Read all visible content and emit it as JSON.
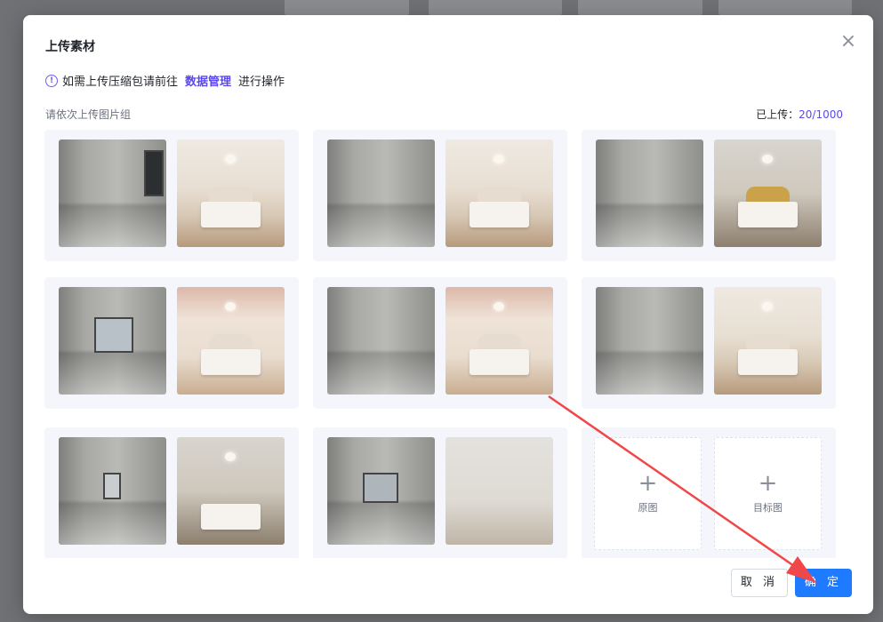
{
  "dialog": {
    "title": "上传素材",
    "notice": {
      "prefix": "如需上传压缩包请前往",
      "link": "数据管理",
      "suffix": "进行操作"
    },
    "hint": "请依次上传图片组",
    "counter": {
      "label": "已上传：",
      "value": "20/1000"
    },
    "upload_slot": {
      "original_label": "原图",
      "target_label": "目标图"
    },
    "buttons": {
      "cancel": "取 消",
      "confirm": "确 定"
    }
  },
  "colors": {
    "accent": "#5a48f0",
    "primary_button": "#1e7bff",
    "annotation_arrow": "#f0484a"
  },
  "icons": {
    "close": "close-icon",
    "info": "info-circle-icon",
    "plus": "plus-icon"
  }
}
